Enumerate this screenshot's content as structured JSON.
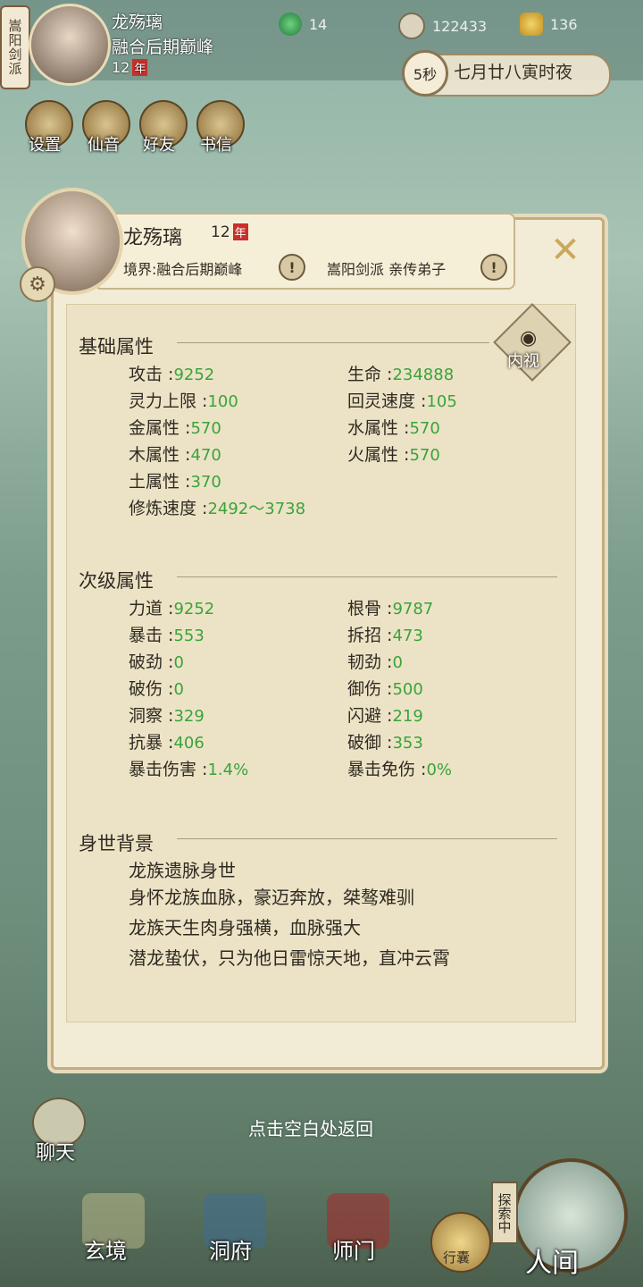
{
  "top": {
    "sect_badge": "嵩阳剑派",
    "player_name": "龙殇璃",
    "realm": "融合后期巅峰",
    "age": "12",
    "age_unit": "年",
    "resources": [
      {
        "icon": "jade-leaf-icon",
        "value": "14"
      },
      {
        "icon": "copper-coin-icon",
        "value": "122433"
      },
      {
        "icon": "strength-icon",
        "value": "136"
      }
    ],
    "time_seconds": "5秒",
    "time_text": "七月廿八寅时夜",
    "tools": [
      "设置",
      "仙音",
      "好友",
      "书信"
    ]
  },
  "dialog": {
    "name": "龙殇璃",
    "age": "12",
    "age_unit": "年",
    "realm_label": "境界:融合后期巅峰",
    "sect_label": "嵩阳剑派 亲传弟子",
    "inner_view_label": "内视",
    "basic": {
      "title": "基础属性",
      "stats": [
        {
          "label": "攻击 :",
          "value": "9252"
        },
        {
          "label": "生命 :",
          "value": "234888"
        },
        {
          "label": "灵力上限 :",
          "value": "100"
        },
        {
          "label": "回灵速度 :",
          "value": "105"
        },
        {
          "label": "金属性 :",
          "value": "570"
        },
        {
          "label": "水属性 :",
          "value": "570"
        },
        {
          "label": "木属性 :",
          "value": "470"
        },
        {
          "label": "火属性 :",
          "value": "570"
        },
        {
          "label": "土属性 :",
          "value": "370"
        },
        {
          "label": "修炼速度 :",
          "value": "2492～3738"
        }
      ]
    },
    "secondary": {
      "title": "次级属性",
      "stats": [
        {
          "label": "力道 :",
          "value": "9252"
        },
        {
          "label": "根骨 :",
          "value": "9787"
        },
        {
          "label": "暴击 :",
          "value": "553"
        },
        {
          "label": "拆招 :",
          "value": "473"
        },
        {
          "label": "破劲 :",
          "value": "0"
        },
        {
          "label": "韧劲 :",
          "value": "0"
        },
        {
          "label": "破伤 :",
          "value": "0"
        },
        {
          "label": "御伤 :",
          "value": "500"
        },
        {
          "label": "洞察 :",
          "value": "329"
        },
        {
          "label": "闪避 :",
          "value": "219"
        },
        {
          "label": "抗暴 :",
          "value": "406"
        },
        {
          "label": "破御 :",
          "value": "353"
        },
        {
          "label": "暴击伤害 :",
          "value": "1.4%"
        },
        {
          "label": "暴击免伤 :",
          "value": "0%"
        }
      ]
    },
    "background": {
      "title": "身世背景",
      "lines": [
        "龙族遗脉身世",
        "身怀龙族血脉，豪迈奔放，桀骜难驯",
        "龙族天生肉身强横，血脉强大",
        "潜龙蛰伏，只为他日雷惊天地，直冲云霄"
      ]
    },
    "hint": "点击空白处返回"
  },
  "bottom": {
    "chat_label": "聊天",
    "nav": [
      "玄境",
      "洞府",
      "师门"
    ],
    "bag_label": "行囊",
    "explore_label": "探索中",
    "world_label": "人间"
  },
  "colors": {
    "value_green": "#3aa33a",
    "accent_red": "#c8302a",
    "gold": "#c9a95a"
  }
}
